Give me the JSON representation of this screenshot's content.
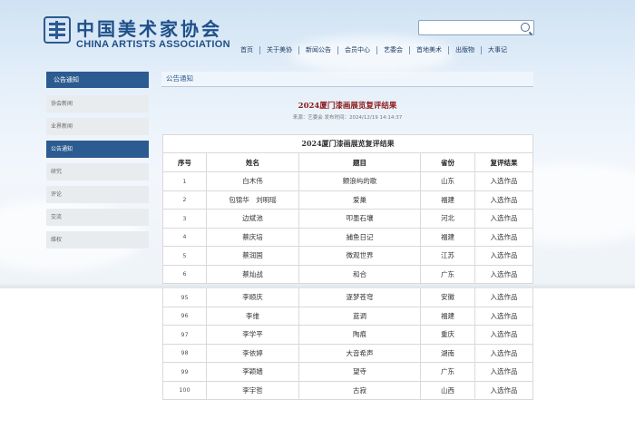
{
  "header": {
    "logo_cn": "中国美术家协会",
    "logo_en": "CHINA ARTISTS ASSOCIATION",
    "search": {
      "value": "",
      "icon": "search-icon"
    },
    "nav": [
      "首页",
      "关于美协",
      "新闻公告",
      "会员中心",
      "艺委会",
      "首地美术",
      "出版物",
      "大事记"
    ]
  },
  "sidebar": {
    "title": "公告通知",
    "items": [
      {
        "label": "协会新闻",
        "active": false
      },
      {
        "label": "业界新闻",
        "active": false
      },
      {
        "label": "公告通知",
        "active": true
      },
      {
        "label": "研究",
        "active": false
      },
      {
        "label": "评论",
        "active": false
      },
      {
        "label": "交流",
        "active": false
      },
      {
        "label": "维权",
        "active": false
      }
    ]
  },
  "content": {
    "section_title": "公告通知",
    "article_title": "2024厦门漆画展览复评结果",
    "meta": "来源：艺委会  发布时间：2024/12/19 14:14:37",
    "table_caption": "2024厦门漆画展览复评结果",
    "columns": [
      "序号",
      "姓名",
      "题目",
      "省份",
      "复评结果"
    ],
    "rows_top": [
      [
        "1",
        "白木伟",
        "颤浪屿的歌",
        "山东",
        "入选作品"
      ],
      [
        "2",
        "包锦华　刘明瑶",
        "爱巢",
        "福建",
        "入选作品"
      ],
      [
        "3",
        "边斌池",
        "叩墨石壤",
        "河北",
        "入选作品"
      ],
      [
        "4",
        "蔡庆培",
        "捕鱼日记",
        "福建",
        "入选作品"
      ],
      [
        "5",
        "蔡润国",
        "微观世界",
        "江苏",
        "入选作品"
      ],
      [
        "6",
        "蔡灿战",
        "和合",
        "广东",
        "入选作品"
      ]
    ],
    "rows_bottom": [
      [
        "95",
        "李顺庆",
        "逐梦苍穹",
        "安徽",
        "入选作品"
      ],
      [
        "96",
        "李维",
        "蓝调",
        "福建",
        "入选作品"
      ],
      [
        "97",
        "李学平",
        "陶痕",
        "重庆",
        "入选作品"
      ],
      [
        "98",
        "李依婷",
        "大音希声",
        "湖南",
        "入选作品"
      ],
      [
        "99",
        "李颖嫱",
        "望寺",
        "广东",
        "入选作品"
      ],
      [
        "100",
        "李宇哲",
        "古寂",
        "山西",
        "入选作品"
      ]
    ]
  }
}
